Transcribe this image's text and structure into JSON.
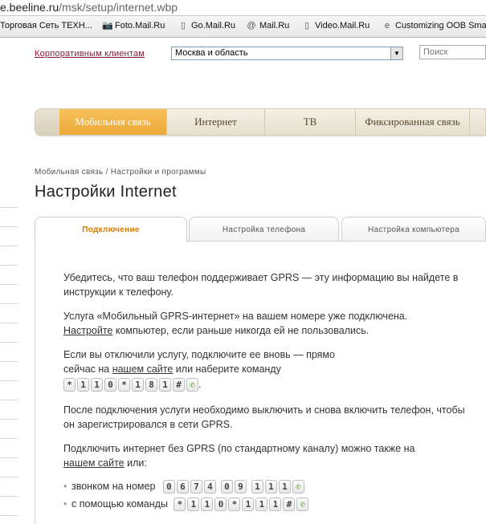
{
  "browser": {
    "url_host": "e.beeline.ru",
    "url_path": "/msk/setup/internet.wbp",
    "favorites": [
      {
        "label": "Торговая Сеть ТЕХН...",
        "icon": "none"
      },
      {
        "label": "Foto.Mail.Ru",
        "icon": "camera-icon"
      },
      {
        "label": "Go.Mail.Ru",
        "icon": "page-icon"
      },
      {
        "label": "Mail.Ru",
        "icon": "at-icon"
      },
      {
        "label": "Video.Mail.Ru",
        "icon": "page-icon"
      },
      {
        "label": "Customizing OOB Sma...",
        "icon": "ie-icon"
      }
    ]
  },
  "header": {
    "corporate_link": "Корпоративным клиентам",
    "region": "Москва и область",
    "search_placeholder": "Поиск"
  },
  "nav": {
    "items": [
      {
        "label": "Мобильная связь",
        "active": true
      },
      {
        "label": "Интернет",
        "active": false
      },
      {
        "label": "ТВ",
        "active": false
      },
      {
        "label": "Фиксированная связь",
        "active": false
      }
    ]
  },
  "breadcrumb": "Мобильная связь / Настройки и программы",
  "page_title": "Настройки Internet",
  "tabs": [
    {
      "label": "Подключение",
      "active": true
    },
    {
      "label": "Настройка телефона",
      "active": false
    },
    {
      "label": "Настройка компьютера",
      "active": false
    }
  ],
  "content": {
    "p1": "Убедитесь, что ваш телефон поддерживает GPRS — эту информацию вы найдете в инструкции к телефону.",
    "p2_line1": "Услуга «Мобильный GPRS-интернет» на вашем номере уже подключена.",
    "p2_link": "Настройте",
    "p2_rest": " компьютер, если раньше никогда ей не пользовались.",
    "p3_line1": "Если вы отключили услугу, подключите ее вновь — прямо",
    "p3_prefix": "сейчас на ",
    "p3_link": "нашем сайте",
    "p3_suffix": " или наберите команду",
    "command1": [
      "*",
      "1",
      "1",
      "0",
      "*",
      "1",
      "8",
      "1",
      "#"
    ],
    "p4": "После подключения услуги необходимо выключить и снова включить телефон, чтобы он зарегистрировался в сети GPRS.",
    "p5_line1": "Подключить интернет без GPRS (по стандартному каналу) можно также на",
    "p5_link": "нашем сайте",
    "p5_suffix": " или:",
    "bullet1": "звонком на номер",
    "phone": [
      "0",
      "6",
      "7",
      "4",
      "0",
      "9",
      "1",
      "1",
      "1"
    ],
    "bullet2": "с помощью команды",
    "command2": [
      "*",
      "1",
      "1",
      "0",
      "*",
      "1",
      "1",
      "1",
      "#"
    ],
    "call_icon": "phone-handset-icon"
  },
  "colors": {
    "nav_active": "#eca838",
    "corporate_link": "#8b1a3a",
    "tab_active_text": "#d77b00"
  }
}
